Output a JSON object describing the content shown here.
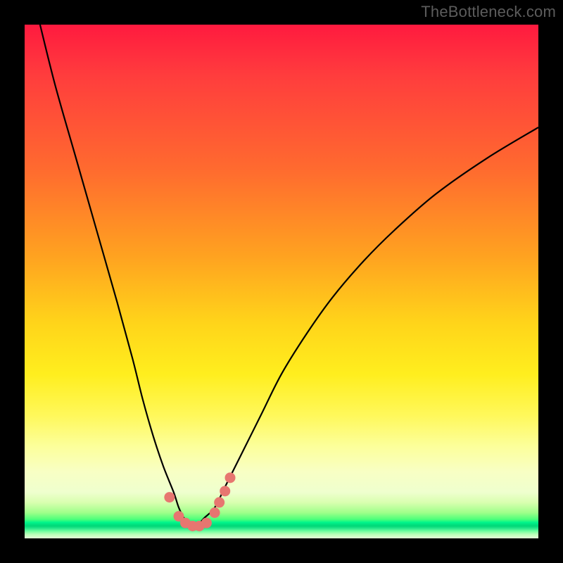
{
  "watermark": "TheBottleneck.com",
  "colors": {
    "frame": "#000000",
    "curve_stroke": "#000000",
    "marker_fill": "#e77670",
    "green_band": "#00e884"
  },
  "chart_data": {
    "type": "line",
    "title": "",
    "xlabel": "",
    "ylabel": "",
    "xlim": [
      0,
      100
    ],
    "ylim": [
      0,
      100
    ],
    "grid": false,
    "legend": false,
    "series": [
      {
        "name": "bottleneck-curve",
        "x": [
          3,
          6,
          10,
          14,
          18,
          21,
          23,
          25,
          27,
          29,
          30,
          31,
          32,
          33,
          34,
          35,
          37,
          39,
          42,
          46,
          50,
          55,
          60,
          66,
          72,
          80,
          90,
          100
        ],
        "y": [
          100,
          88,
          74,
          60,
          46,
          35,
          27,
          20,
          14,
          9,
          6,
          4,
          3,
          3,
          3,
          4,
          6,
          10,
          16,
          24,
          32,
          40,
          47,
          54,
          60,
          67,
          74,
          80
        ]
      }
    ],
    "markers": {
      "name": "highlighted-points",
      "points": [
        {
          "x": 28.2,
          "y": 8.0
        },
        {
          "x": 30.0,
          "y": 4.3
        },
        {
          "x": 31.3,
          "y": 3.0
        },
        {
          "x": 32.7,
          "y": 2.4
        },
        {
          "x": 34.0,
          "y": 2.4
        },
        {
          "x": 35.4,
          "y": 3.0
        },
        {
          "x": 37.0,
          "y": 5.0
        },
        {
          "x": 37.9,
          "y": 7.0
        },
        {
          "x": 39.0,
          "y": 9.2
        },
        {
          "x": 40.0,
          "y": 11.8
        }
      ]
    }
  }
}
